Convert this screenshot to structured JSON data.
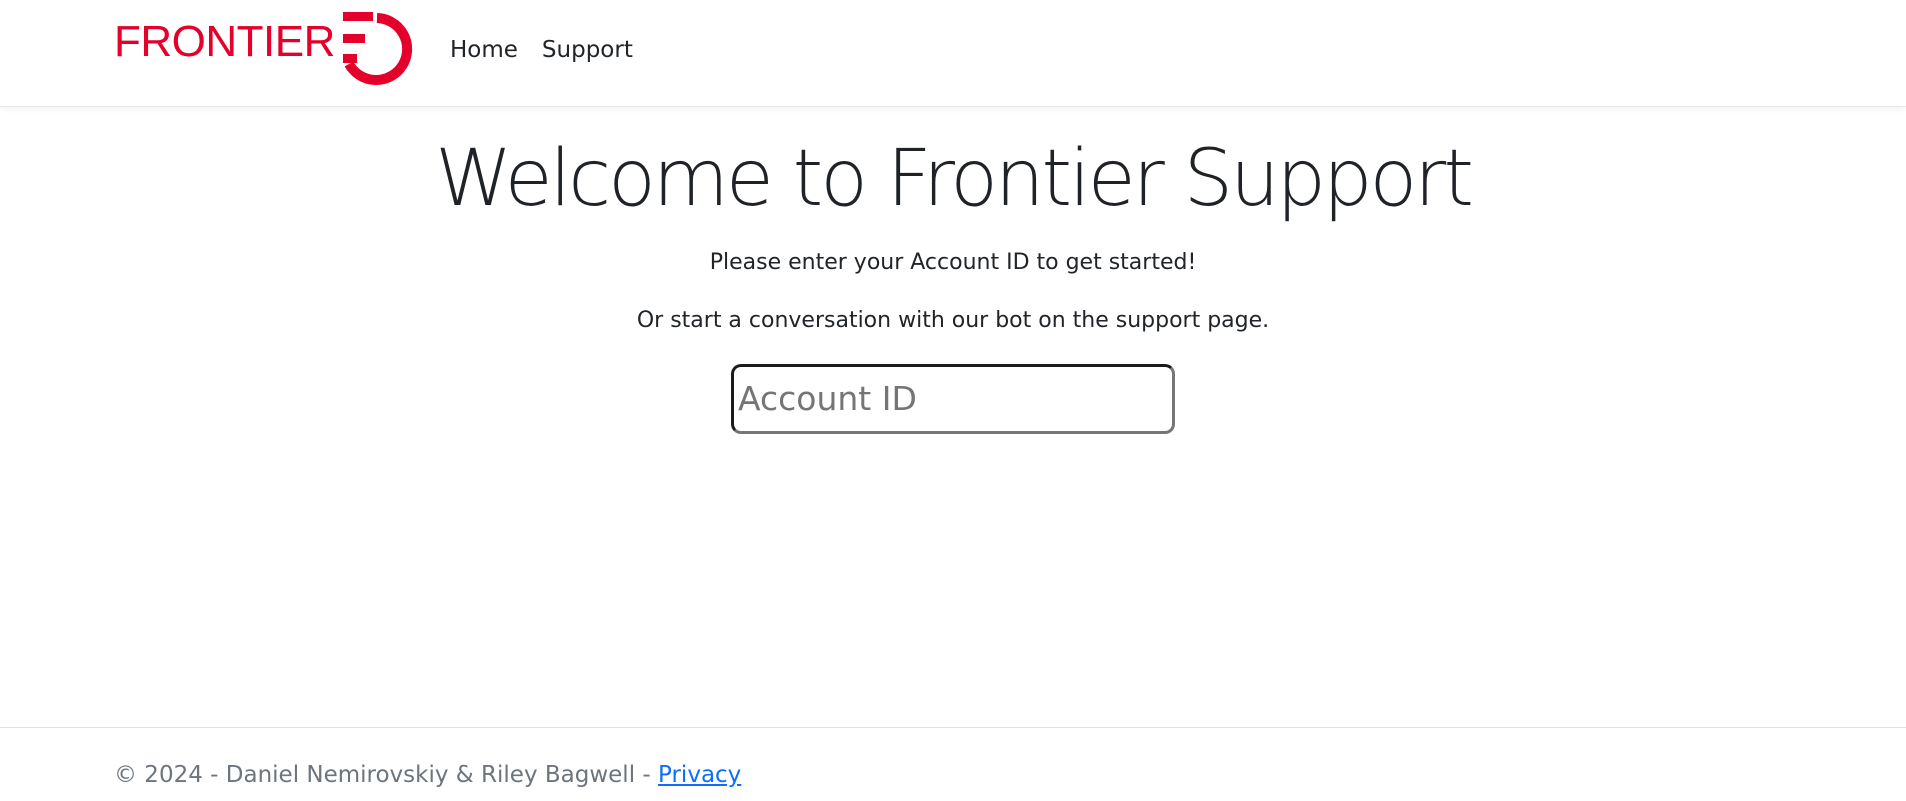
{
  "brand": {
    "logo_text": "FRONTIER",
    "logo_color": "#e4002b"
  },
  "nav": {
    "items": [
      {
        "label": "Home"
      },
      {
        "label": "Support"
      }
    ]
  },
  "main": {
    "title": "Welcome to Frontier Support",
    "lead": "Please enter your Account ID to get started!",
    "secondary": "Or start a conversation with our bot on the support page.",
    "account_input": {
      "placeholder": "Account ID",
      "value": ""
    }
  },
  "footer": {
    "copyright": "© 2024 - Daniel Nemirovskiy & Riley Bagwell - ",
    "privacy_link": "Privacy",
    "link_color": "#0d6efd"
  }
}
